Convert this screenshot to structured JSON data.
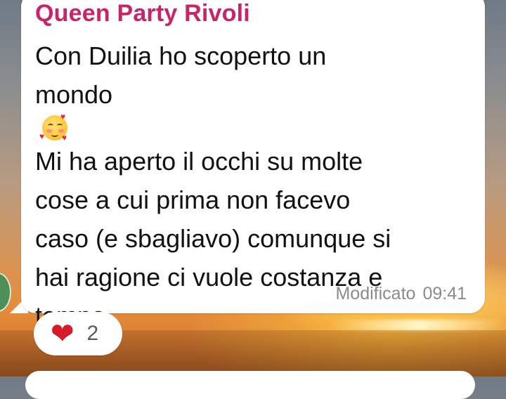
{
  "message": {
    "sender": "Queen Party Rivoli",
    "lines": [
      "Con Duilia ho scoperto un",
      "mondo",
      "Mi ha aperto il occhi su molte",
      "cose a cui prima non facevo",
      "caso (e sbagliavo) comunque si",
      "hai ragione ci vuole costanza e",
      "tempo"
    ],
    "inline_emoji": "smiling-face-with-hearts",
    "edited_label": "Modificato",
    "time": "09:41"
  },
  "reaction": {
    "emoji": "red-heart",
    "count": "2"
  },
  "colors": {
    "sender": "#c8236b",
    "bubble": "#ffffff",
    "meta_text": "#8a8a8f",
    "reaction_heart": "#d91a2a"
  }
}
